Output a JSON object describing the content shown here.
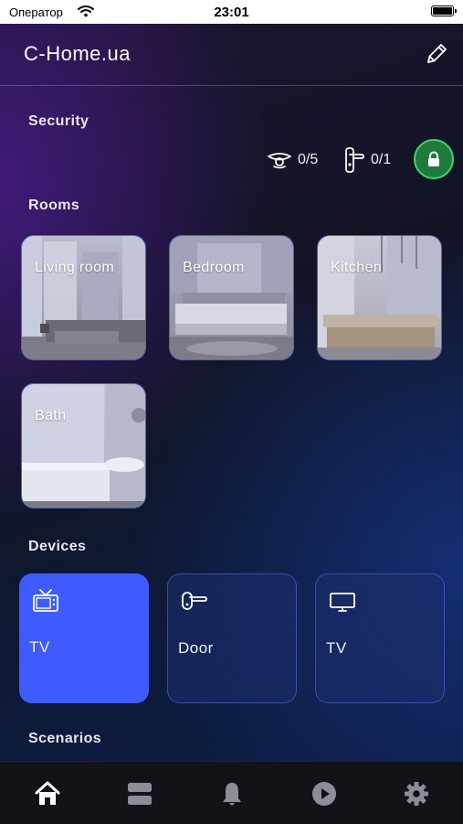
{
  "status_bar": {
    "carrier": "Оператор",
    "time": "23:01"
  },
  "header": {
    "title": "C-Home.ua",
    "edit_icon": "pencil-icon"
  },
  "security": {
    "title": "Security",
    "sensors": {
      "icon": "motion-sensor-icon",
      "value": "0/5"
    },
    "locks": {
      "icon": "door-handle-icon",
      "value": "0/1"
    },
    "lock_state_color": "#3fd46b"
  },
  "rooms": {
    "title": "Rooms",
    "items": [
      {
        "label": "Living room"
      },
      {
        "label": "Bedroom"
      },
      {
        "label": "Kitchen"
      },
      {
        "label": "Bath"
      }
    ]
  },
  "devices": {
    "title": "Devices",
    "items": [
      {
        "label": "TV",
        "icon": "tv-icon",
        "active": true
      },
      {
        "label": "Door",
        "icon": "door-handle-icon",
        "active": false
      },
      {
        "label": "TV",
        "icon": "monitor-icon",
        "active": false
      }
    ],
    "active_color": "#3d5bff"
  },
  "scenarios": {
    "title": "Scenarios"
  },
  "tabbar": {
    "items": [
      {
        "icon": "home-icon",
        "selected": true
      },
      {
        "icon": "list-icon",
        "selected": false
      },
      {
        "icon": "bell-icon",
        "selected": false
      },
      {
        "icon": "play-icon",
        "selected": false
      },
      {
        "icon": "gear-icon",
        "selected": false
      }
    ]
  }
}
